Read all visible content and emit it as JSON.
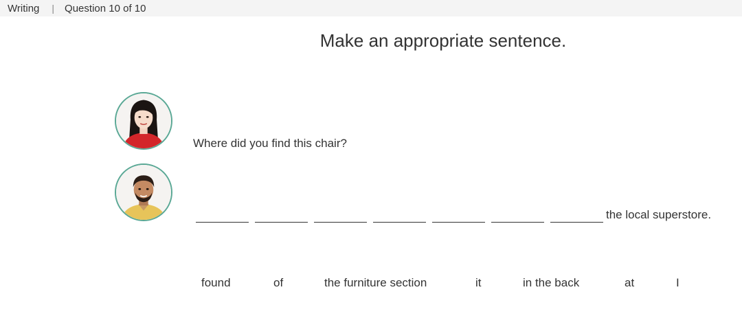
{
  "header": {
    "section": "Writing",
    "separator": "|",
    "progress": "Question 10 of 10"
  },
  "instruction": "Make an appropriate sentence.",
  "dialogue": {
    "speaker_1": {
      "avatar_icon": "woman-avatar-icon",
      "text": "Where did you find this chair?"
    },
    "speaker_2": {
      "avatar_icon": "man-avatar-icon"
    }
  },
  "answer": {
    "blank_count": 7,
    "suffix": "the local superstore."
  },
  "word_bank": [
    "found",
    "of",
    "the furniture section",
    "it",
    "in the back",
    "at",
    "I"
  ],
  "colors": {
    "avatar_border": "#5aa895",
    "header_bg": "#f4f4f4"
  }
}
